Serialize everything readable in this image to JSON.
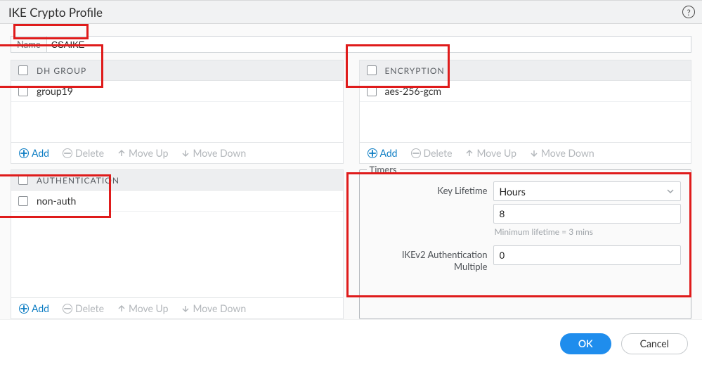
{
  "titlebar": {
    "title": "IKE Crypto Profile"
  },
  "name": {
    "label": "Name",
    "value": "CSAIKE"
  },
  "dhgroup": {
    "header": "DH GROUP",
    "rows": [
      {
        "label": "group19"
      }
    ]
  },
  "encryption": {
    "header": "ENCRYPTION",
    "rows": [
      {
        "label": "aes-256-gcm"
      }
    ]
  },
  "authentication": {
    "header": "AUTHENTICATION",
    "rows": [
      {
        "label": "non-auth"
      }
    ]
  },
  "toolbar": {
    "add": "Add",
    "delete": "Delete",
    "moveup": "Move Up",
    "movedown": "Move Down"
  },
  "timers": {
    "legend": "Timers",
    "key_lifetime_label": "Key Lifetime",
    "key_lifetime_unit": "Hours",
    "key_lifetime_value": "8",
    "key_lifetime_helper": "Minimum lifetime = 3 mins",
    "ikev2_multiple_label": "IKEv2 Authentication Multiple",
    "ikev2_multiple_value": "0"
  },
  "footer": {
    "ok": "OK",
    "cancel": "Cancel"
  }
}
